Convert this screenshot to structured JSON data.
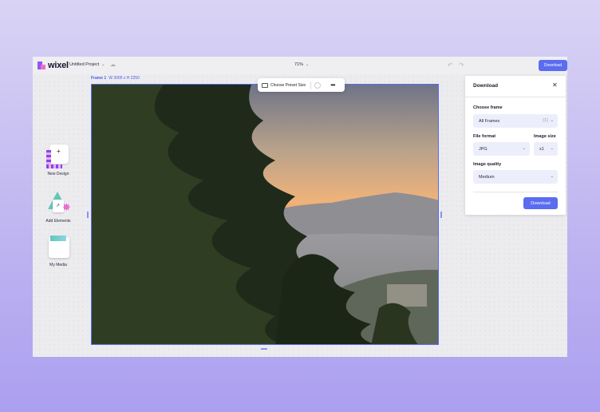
{
  "app": {
    "logo_text": "wixel",
    "project_name": "Untitled Project"
  },
  "header": {
    "zoom": "71%",
    "download_label": "Download"
  },
  "canvas": {
    "frame_name": "Frame 1",
    "frame_dims": "W 3000 x H 2250",
    "preset_label": "Choose Preset Size"
  },
  "tools": [
    {
      "label": "New Design"
    },
    {
      "label": "Add Elements"
    },
    {
      "label": "My Media"
    }
  ],
  "download_panel": {
    "title": "Download",
    "choose_frame_label": "Choose frame",
    "choose_frame_value": "All Frames",
    "choose_frame_count": "(1)",
    "file_format_label": "File format",
    "file_format_value": "JPG",
    "image_size_label": "Image size",
    "image_size_value": "x1",
    "image_quality_label": "Image quality",
    "image_quality_value": "Medium",
    "download_button": "Download"
  },
  "colors": {
    "accent": "#5a6cf0",
    "brand_purple": "#8a5bf0",
    "brand_pink": "#f06ad0"
  },
  "icons": [
    "logo-icon",
    "chevron-down-icon",
    "cloud-icon",
    "undo-icon",
    "redo-icon",
    "preset-size-icon",
    "more-icon",
    "close-icon",
    "plus-icon"
  ]
}
